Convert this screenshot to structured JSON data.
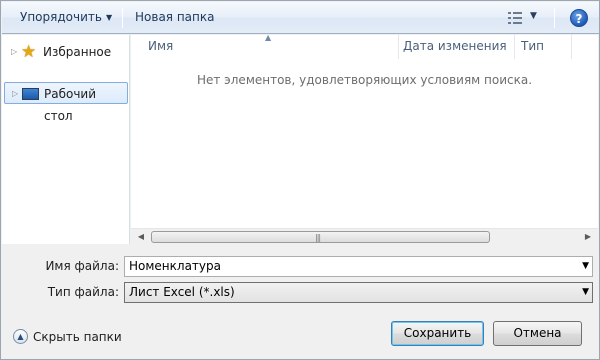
{
  "toolbar": {
    "organize_label": "Упорядочить",
    "new_folder_label": "Новая папка",
    "view_icon": "view-details-icon",
    "help_label": "?"
  },
  "nav": {
    "items": [
      {
        "label": "Избранное",
        "icon": "star-icon",
        "selected": false
      },
      {
        "label": "Рабочий стол",
        "icon": "desktop-icon",
        "selected": true
      }
    ]
  },
  "list": {
    "columns": [
      "Имя",
      "Дата изменения",
      "Тип"
    ],
    "empty_message": "Нет элементов, удовлетворяющих условиям поиска."
  },
  "form": {
    "filename_label": "Имя файла:",
    "filename_value": "Номенклатура",
    "filetype_label": "Тип файла:",
    "filetype_value": "Лист Excel (*.xls)"
  },
  "footer": {
    "hide_folders_label": "Скрыть папки",
    "save_label": "Сохранить",
    "cancel_label": "Отмена"
  },
  "colors": {
    "selection_border": "#84acdd",
    "toolbar_text": "#1e395b",
    "empty_text": "#6d6d6d"
  }
}
